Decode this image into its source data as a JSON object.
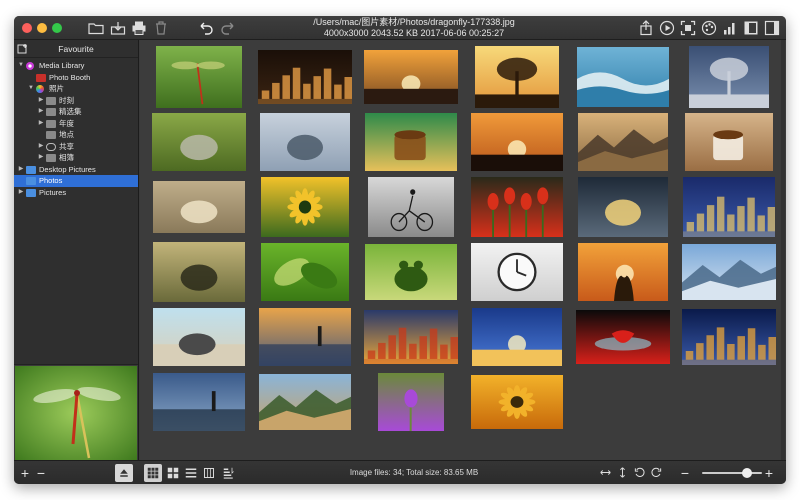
{
  "window": {
    "path": "/Users/mac/图片素材/Photos/dragonfly-177338.jpg",
    "info": "4000x3000  2043.52 KB  2017-06-06 00:25:27"
  },
  "toolbar": {
    "icons": [
      "open-folder-icon",
      "export-icon",
      "print-icon",
      "trash-icon",
      "undo-icon",
      "redo-icon",
      "share-icon",
      "slideshow-icon",
      "fullscreen-icon",
      "palette-icon",
      "histogram-icon",
      "sidebar-left-icon",
      "sidebar-right-icon"
    ]
  },
  "sidebar": {
    "header": "Favourite",
    "items": [
      {
        "label": "Media Library",
        "arrow": "▼",
        "icon": "media-library-icon",
        "indent": 0
      },
      {
        "label": "Photo Booth",
        "arrow": "",
        "icon": "photo-booth-icon",
        "indent": 1
      },
      {
        "label": "照片",
        "arrow": "▼",
        "icon": "photos-app-icon",
        "indent": 1
      },
      {
        "label": "时刻",
        "arrow": "▶",
        "icon": "album-icon",
        "indent": 2
      },
      {
        "label": "精选集",
        "arrow": "▶",
        "icon": "album-icon",
        "indent": 2
      },
      {
        "label": "年度",
        "arrow": "▶",
        "icon": "album-icon",
        "indent": 2
      },
      {
        "label": "地点",
        "arrow": "",
        "icon": "album-icon",
        "indent": 2
      },
      {
        "label": "共享",
        "arrow": "▶",
        "icon": "cloud-icon",
        "indent": 2
      },
      {
        "label": "相簿",
        "arrow": "▶",
        "icon": "album-icon",
        "indent": 2
      },
      {
        "label": "Desktop Pictures",
        "arrow": "▶",
        "icon": "folder-icon",
        "indent": 0
      },
      {
        "label": "Photos",
        "arrow": "",
        "icon": "folder-icon",
        "indent": 0,
        "selected": true
      },
      {
        "label": "Pictures",
        "arrow": "▶",
        "icon": "folder-icon",
        "indent": 0
      }
    ]
  },
  "preview": {
    "subject": "dragonfly"
  },
  "thumbnails": [
    {
      "subject": "dragonfly",
      "colors": [
        "#7fb24a",
        "#3f6f1e",
        "#c8d27a"
      ],
      "shape": "dragonfly"
    },
    {
      "subject": "city night skyline",
      "colors": [
        "#1a0f08",
        "#3b2412",
        "#f2a64a"
      ],
      "shape": "city"
    },
    {
      "subject": "city sunset",
      "colors": [
        "#f1a23b",
        "#7a4a22",
        "#2b1a10"
      ],
      "shape": "sunset"
    },
    {
      "subject": "tree sunset",
      "colors": [
        "#f7d97a",
        "#e3953a",
        "#2b1a0a"
      ],
      "shape": "tree"
    },
    {
      "subject": "ocean wave",
      "colors": [
        "#6fb3d6",
        "#2f7eaa",
        "#eaf3f6"
      ],
      "shape": "wave"
    },
    {
      "subject": "lone tree clouds",
      "colors": [
        "#3a4f74",
        "#7a8fae",
        "#c9cfd9"
      ],
      "shape": "tree"
    },
    {
      "subject": "kitten in grass",
      "colors": [
        "#8aa847",
        "#4d6a22",
        "#b8b8a8"
      ],
      "shape": "cat"
    },
    {
      "subject": "bird on flower",
      "colors": [
        "#c7d1dc",
        "#8fa0b4",
        "#4b5a6a"
      ],
      "shape": "bird"
    },
    {
      "subject": "tea cup",
      "colors": [
        "#2e8a4a",
        "#e7c05a",
        "#8a4f1a"
      ],
      "shape": "cup"
    },
    {
      "subject": "dogs silhouette sunset",
      "colors": [
        "#f09a3a",
        "#b8561a",
        "#1a0e08"
      ],
      "shape": "sunset"
    },
    {
      "subject": "misty valley",
      "colors": [
        "#d9b27a",
        "#8a6a42",
        "#4a3a2a"
      ],
      "shape": "hills"
    },
    {
      "subject": "coffee and notebook",
      "colors": [
        "#d6b48a",
        "#9a6e44",
        "#f4ede2"
      ],
      "shape": "cup"
    },
    {
      "subject": "crab on sand",
      "colors": [
        "#bfae8a",
        "#8a7a5a",
        "#efe3c6"
      ],
      "shape": "crab"
    },
    {
      "subject": "yellow flower",
      "colors": [
        "#f2c22a",
        "#3c6a1e",
        "#1e3a10"
      ],
      "shape": "flower"
    },
    {
      "subject": "bicycle silhouette",
      "colors": [
        "#d8d8d8",
        "#8a8a8a",
        "#1a1a1a"
      ],
      "shape": "bike"
    },
    {
      "subject": "red tulips",
      "colors": [
        "#2a2a1a",
        "#d8301a",
        "#3a6a1e"
      ],
      "shape": "tulips"
    },
    {
      "subject": "sparkler girl",
      "colors": [
        "#1e2a38",
        "#5a6a7a",
        "#f2d27a"
      ],
      "shape": "girl"
    },
    {
      "subject": "city lights tower",
      "colors": [
        "#1a2a6a",
        "#3a5aaa",
        "#e2c26a"
      ],
      "shape": "city"
    },
    {
      "subject": "grass seeds",
      "colors": [
        "#c2b47a",
        "#6a6a3a",
        "#2a2a1a"
      ],
      "shape": "grass"
    },
    {
      "subject": "green leaves",
      "colors": [
        "#6ab42a",
        "#3a7a14",
        "#cde07a"
      ],
      "shape": "leaves"
    },
    {
      "subject": "frog figurine",
      "colors": [
        "#7ab43a",
        "#c8d87a",
        "#2e5a12"
      ],
      "shape": "frog"
    },
    {
      "subject": "alarm clock",
      "colors": [
        "#f2f2f2",
        "#cfcfcf",
        "#2a2a2a"
      ],
      "shape": "clock"
    },
    {
      "subject": "couple sunset",
      "colors": [
        "#f2a23a",
        "#c85a1a",
        "#2a1a0a"
      ],
      "shape": "couple"
    },
    {
      "subject": "snowy mountains",
      "colors": [
        "#7aa8d8",
        "#d8e4f0",
        "#4a6a8a"
      ],
      "shape": "mountain"
    },
    {
      "subject": "rock on beach",
      "colors": [
        "#bfe0ee",
        "#d8cfb8",
        "#4a4a4a"
      ],
      "shape": "rock"
    },
    {
      "subject": "pier sunset",
      "colors": [
        "#e8a44a",
        "#4a5a7a",
        "#2a3a5a"
      ],
      "shape": "pier"
    },
    {
      "subject": "city light trails",
      "colors": [
        "#2a3a6a",
        "#e8a43a",
        "#c83a1a"
      ],
      "shape": "city"
    },
    {
      "subject": "sunrise horizon",
      "colors": [
        "#1a3a8a",
        "#4a7ad8",
        "#f2c25a"
      ],
      "shape": "sunset"
    },
    {
      "subject": "strawberry splash",
      "colors": [
        "#0a0a0a",
        "#d8201a",
        "#8ad8e8"
      ],
      "shape": "berry"
    },
    {
      "subject": "city waterfront night",
      "colors": [
        "#0a1a4a",
        "#3a5aaa",
        "#e8a43a"
      ],
      "shape": "city"
    },
    {
      "subject": "lighthouse dusk",
      "colors": [
        "#3a5a8a",
        "#8aa8c8",
        "#1a2a3a"
      ],
      "shape": "pier"
    },
    {
      "subject": "mountain valley",
      "colors": [
        "#8ab4d8",
        "#c8a46a",
        "#3a5a2a"
      ],
      "shape": "mountain"
    },
    {
      "subject": "thistle bee",
      "colors": [
        "#6a8a3a",
        "#a84ad8",
        "#c8d4a8"
      ],
      "shape": "thistle"
    },
    {
      "subject": "yellow flower macro",
      "colors": [
        "#f2b22a",
        "#c86a0a",
        "#3a2a0a"
      ],
      "shape": "flower"
    }
  ],
  "status": {
    "text": "Image files: 34;  Total size: 83.65 MB",
    "zoom_fraction": 0.75
  },
  "bottom": {
    "add": "+",
    "remove": "−",
    "zoom_out": "−",
    "zoom_in": "+"
  }
}
